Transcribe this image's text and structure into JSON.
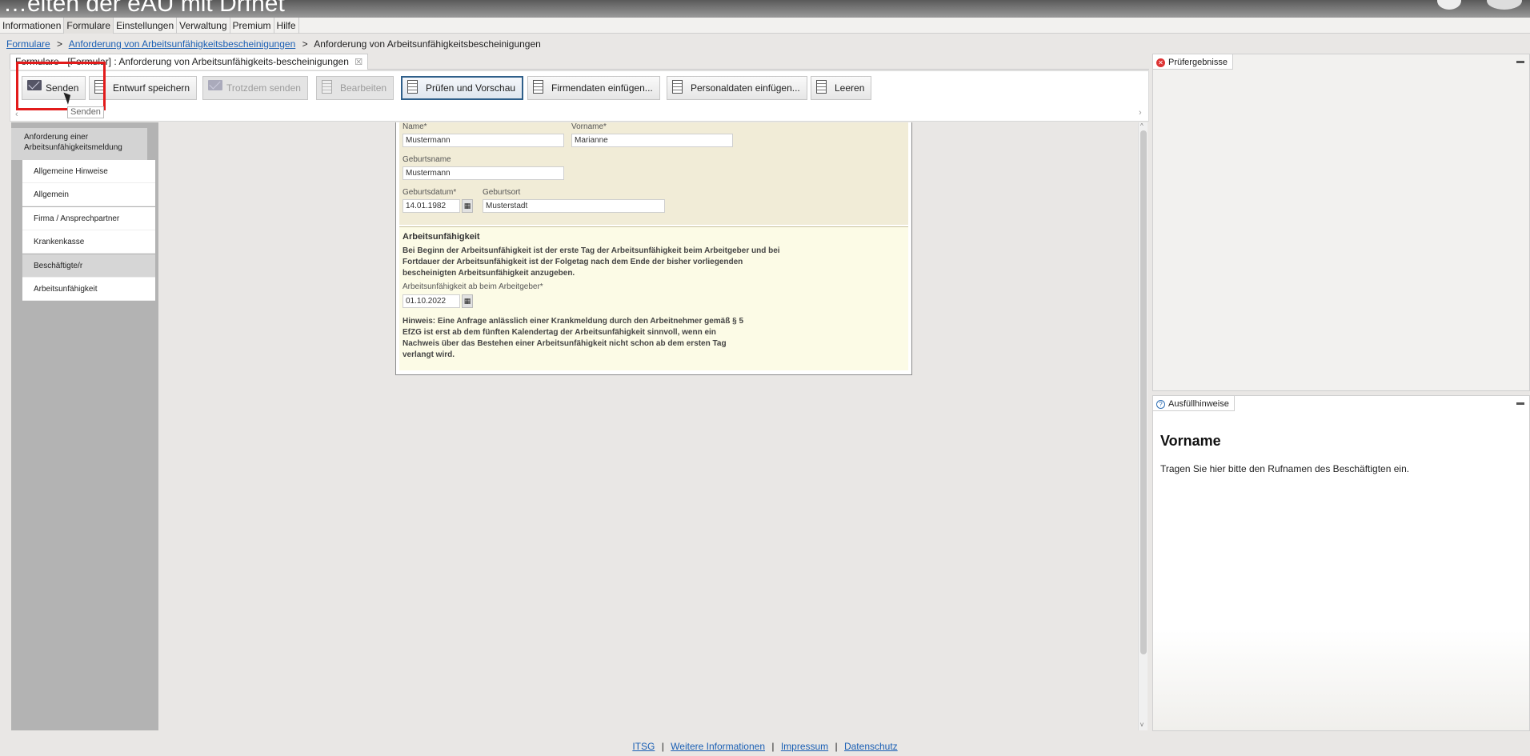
{
  "video": {
    "title_fragment": "…eiten der eAU mit Drfnet"
  },
  "menu": [
    "Informationen",
    "Formulare",
    "Einstellungen",
    "Verwaltung",
    "Premium",
    "Hilfe"
  ],
  "breadcrumb": {
    "item1": "Formulare",
    "item2": "Anforderung von Arbeitsunfähigkeitsbescheinigungen",
    "current": "Anforderung von Arbeitsunfähigkeitsbescheinigungen",
    "sep": ">"
  },
  "editor_tab": {
    "label": "Formulare - [Formular] : Anforderung von Arbeitsunfähigkeits-bescheinigungen",
    "close": "☒"
  },
  "toolbar": {
    "send": "Senden",
    "save_draft": "Entwurf speichern",
    "send_anyway": "Trotzdem senden",
    "edit": "Bearbeiten",
    "check_preview": "Prüfen und Vorschau",
    "insert_company": "Firmendaten einfügen...",
    "insert_personal": "Personaldaten einfügen...",
    "clear": "Leeren",
    "tooltip": "Senden"
  },
  "nav": {
    "header": "Anforderung einer Arbeitsunfähigkeitsmeldung",
    "items": [
      "Allgemeine Hinweise",
      "Allgemein",
      "Firma / Ansprechpartner",
      "Krankenkasse",
      "Beschäftigte/r",
      "Arbeitsunfähigkeit"
    ]
  },
  "form": {
    "name_label": "Name*",
    "name_value": "Mustermann",
    "vorname_label": "Vorname*",
    "vorname_value": "Marianne",
    "geburtsname_label": "Geburtsname",
    "geburtsname_value": "Mustermann",
    "geburtsdatum_label": "Geburtsdatum*",
    "geburtsdatum_value": "14.01.1982",
    "geburtsort_label": "Geburtsort",
    "geburtsort_value": "Musterstadt",
    "au_title": "Arbeitsunfähigkeit",
    "au_text": "Bei Beginn der Arbeitsunfähigkeit ist der erste Tag der Arbeitsunfähigkeit beim Arbeitgeber und bei Fortdauer der Arbeitsunfähigkeit ist der Folgetag nach dem Ende der bisher vorliegenden bescheinigten Arbeitsunfähigkeit anzugeben.",
    "au_ab_label": "Arbeitsunfähigkeit ab beim Arbeitgeber*",
    "au_ab_value": "01.10.2022",
    "hinweis": "Hinweis: Eine Anfrage anlässlich einer Krankmeldung durch den Arbeitnehmer gemäß § 5 EfZG ist erst ab dem fünften Kalendertag der Arbeitsunfähigkeit sinnvoll, wenn ein Nachweis über das Bestehen einer Arbeitsunfähigkeit nicht schon ab dem ersten Tag verlangt wird."
  },
  "panels": {
    "results_title": "Prüfergebnisse",
    "hints_title": "Ausfüllhinweise",
    "hint_heading": "Vorname",
    "hint_text": "Tragen Sie hier bitte den Rufnamen des Beschäftigten ein."
  },
  "footer": {
    "itsg": "ITSG",
    "more": "Weitere Informationen",
    "impressum": "Impressum",
    "datenschutz": "Datenschutz",
    "sep": "|"
  }
}
